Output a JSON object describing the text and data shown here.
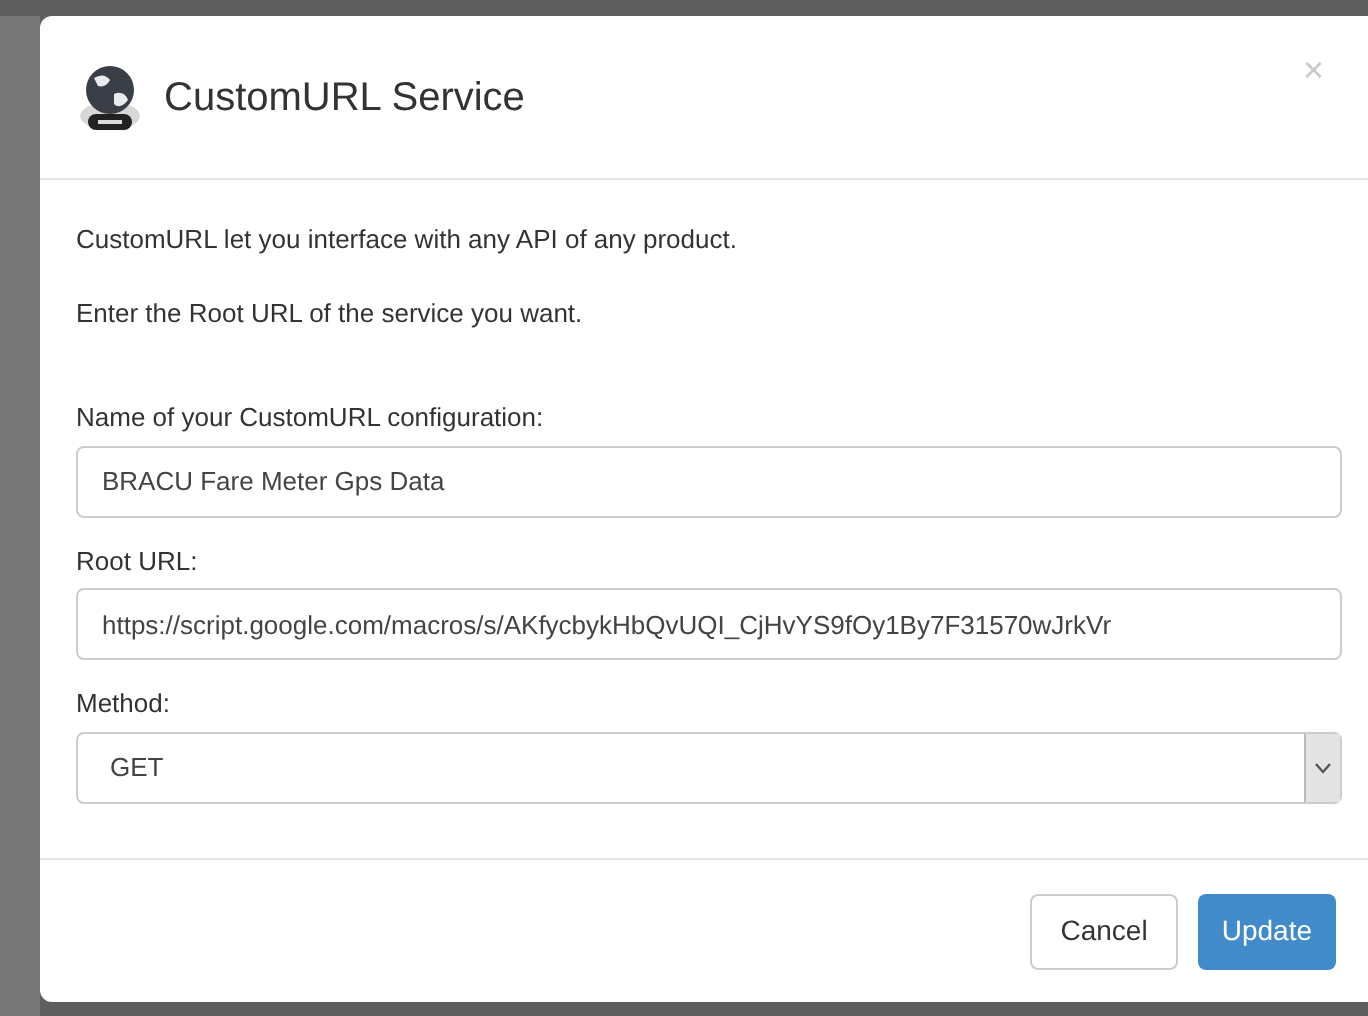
{
  "dialog": {
    "title": "CustomURL Service",
    "close": "×",
    "intro": [
      "CustomURL let you interface with any API of any product.",
      "Enter the Root URL of the service you want."
    ],
    "fields": [
      {
        "kind": "text",
        "label": "Name of your CustomURL configuration:",
        "value": "BRACU Fare Meter Gps Data"
      },
      {
        "kind": "text",
        "label": "Root URL:",
        "value": "https://script.google.com/macros/s/AKfycbykHbQvUQI_CjHvYS9fOy1By7F31570wJrkVr"
      },
      {
        "kind": "select",
        "label": "Method:",
        "value": "GET"
      }
    ],
    "buttons": [
      {
        "label": "Cancel",
        "kind": "default"
      },
      {
        "label": "Update",
        "kind": "primary"
      }
    ]
  }
}
